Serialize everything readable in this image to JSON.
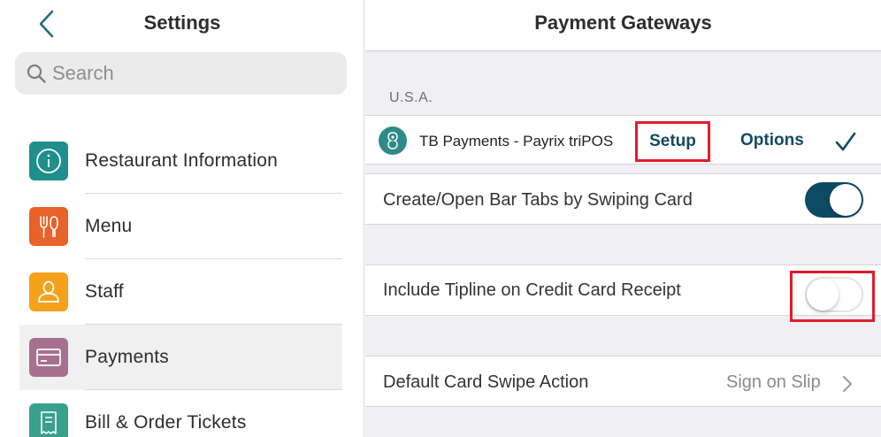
{
  "left": {
    "title": "Settings",
    "search_placeholder": "Search",
    "items": [
      {
        "label": "Restaurant Information",
        "icon": "info-icon",
        "color": "#1f8f8d",
        "selected": false
      },
      {
        "label": "Menu",
        "icon": "fork-knife-icon",
        "color": "#e8622a",
        "selected": false
      },
      {
        "label": "Staff",
        "icon": "person-icon",
        "color": "#f5a11c",
        "selected": false
      },
      {
        "label": "Payments",
        "icon": "card-icon",
        "color": "#a8708f",
        "selected": true
      },
      {
        "label": "Bill & Order Tickets",
        "icon": "receipt-icon",
        "color": "#3aa08e",
        "selected": false
      }
    ]
  },
  "right": {
    "title": "Payment Gateways",
    "section_label": "U.S.A.",
    "gateway": {
      "name": "TB Payments - Payrix triPOS",
      "setup_label": "Setup",
      "options_label": "Options"
    },
    "bar_tabs": {
      "label": "Create/Open Bar Tabs by Swiping Card",
      "on": true
    },
    "tipline": {
      "label": "Include Tipline on Credit Card Receipt",
      "on": false
    },
    "swipe_action": {
      "label": "Default Card Swipe Action",
      "value": "Sign on Slip"
    }
  },
  "colors": {
    "accent": "#0d4a63",
    "highlight_red": "#e31c2b",
    "back_arrow": "#1a6d7a"
  }
}
